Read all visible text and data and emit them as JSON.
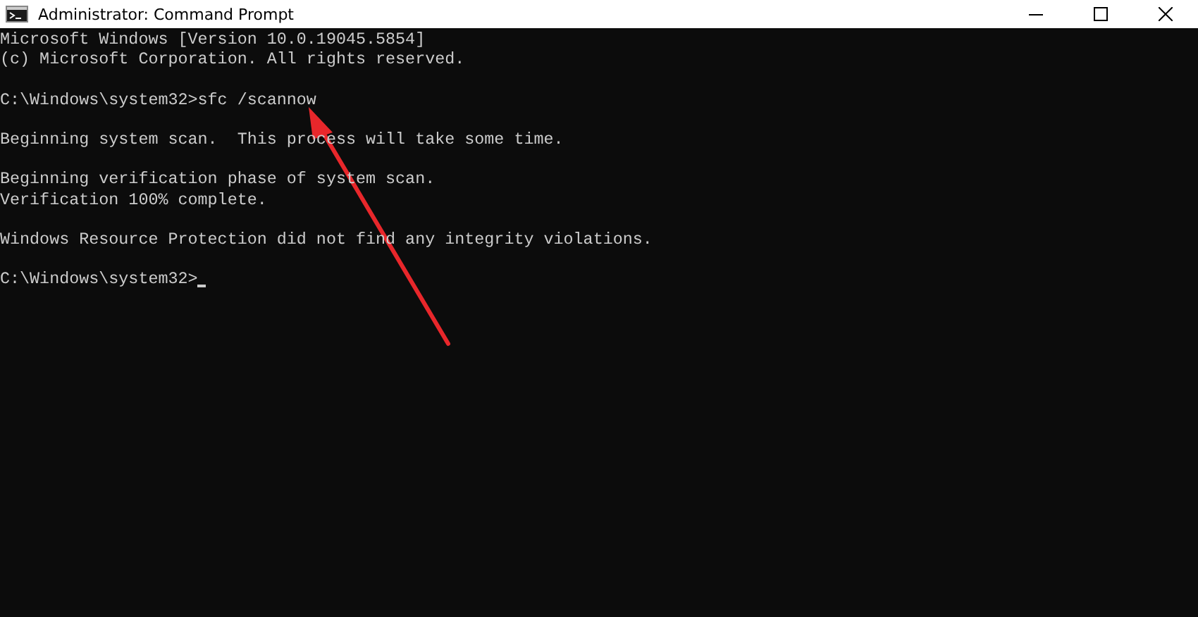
{
  "window": {
    "title": "Administrator: Command Prompt"
  },
  "console": {
    "blocks": [
      [
        "Microsoft Windows [Version 10.0.19045.5854]",
        "(c) Microsoft Corporation. All rights reserved."
      ],
      [
        "C:\\Windows\\system32>sfc /scannow"
      ],
      [
        "Beginning system scan.  This process will take some time."
      ],
      [
        "Beginning verification phase of system scan.",
        "Verification 100% complete."
      ],
      [
        "Windows Resource Protection did not find any integrity violations."
      ]
    ],
    "prompt": {
      "text": "C:\\Windows\\system32>",
      "cursor": true
    }
  }
}
